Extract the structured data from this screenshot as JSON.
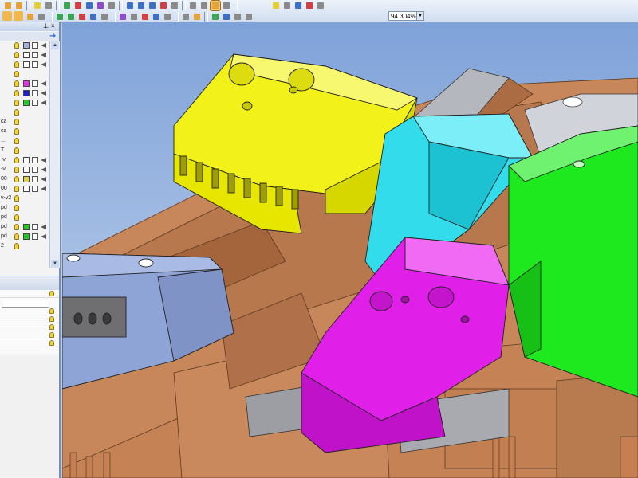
{
  "toolbar": {
    "zoom_value": "94.304%",
    "zoom_dropdown_glyph": "▼"
  },
  "left_panel": {
    "pin_glyph": "⊥",
    "close_glyph": "×",
    "layers": [
      {
        "name": "",
        "swatch": "#9fb1d8"
      },
      {
        "name": "",
        "swatch": "#ffffff"
      },
      {
        "name": "",
        "swatch": "#ffffff"
      },
      {
        "name": "",
        "swatch": null
      },
      {
        "name": "",
        "swatch": "#e234e2"
      },
      {
        "name": "",
        "swatch": "#2020c8"
      },
      {
        "name": "",
        "swatch": "#25c825"
      },
      {
        "name": "",
        "swatch": null
      },
      {
        "name": "ca",
        "swatch": null
      },
      {
        "name": "ca",
        "swatch": null
      },
      {
        "name": "...",
        "swatch": null
      },
      {
        "name": "T",
        "swatch": null
      },
      {
        "name": "-v",
        "swatch": "#ffffff"
      },
      {
        "name": "-v",
        "swatch": "#ffffff"
      },
      {
        "name": "00",
        "swatch": "#e0d24a"
      },
      {
        "name": "00",
        "swatch": "#ffffff"
      },
      {
        "name": "v-v2",
        "swatch": null
      },
      {
        "name": "pd",
        "swatch": null
      },
      {
        "name": "pd",
        "swatch": null
      },
      {
        "name": "pd",
        "swatch": "#25c825"
      },
      {
        "name": "pd",
        "swatch": "#25c825"
      },
      {
        "name": "2",
        "swatch": null
      }
    ]
  },
  "viewport": {
    "background_top": "#7fa2d9",
    "background_bottom": "#c9d9ee",
    "colors": {
      "copper": "#c8875a",
      "copper_dark": "#a5653c",
      "yellow": "#f2f21a",
      "cyan": "#32dcea",
      "green": "#1ee81e",
      "magenta": "#e020e8",
      "slate_blue": "#8ea3d6",
      "steel": "#b4b8be"
    }
  }
}
